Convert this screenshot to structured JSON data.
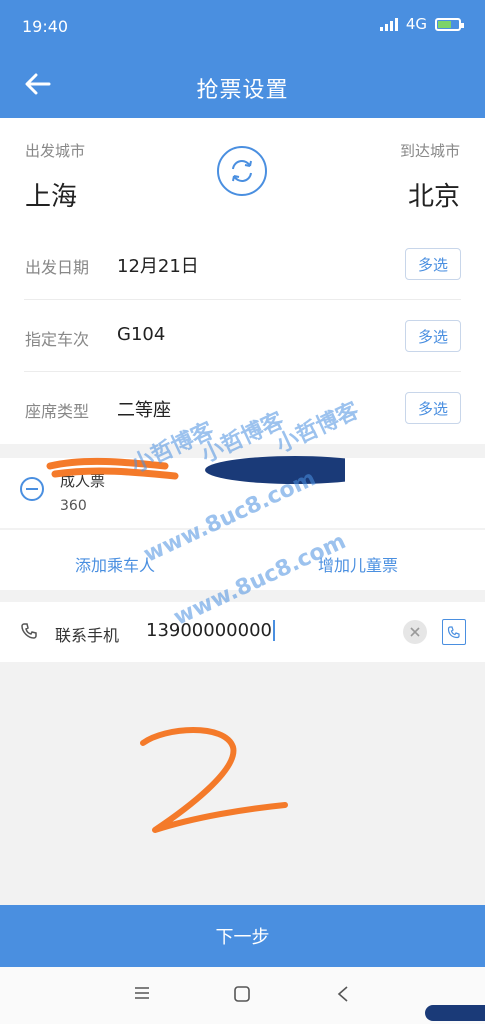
{
  "status_bar": {
    "time": "19:40",
    "network": "4G"
  },
  "header": {
    "title": "抢票设置",
    "back_icon": "back-arrow-icon"
  },
  "route": {
    "from_label": "出发城市",
    "from_city": "上海",
    "to_label": "到达城市",
    "to_city": "北京"
  },
  "settings": [
    {
      "label": "出发日期",
      "value": "12月21日",
      "button": "多选"
    },
    {
      "label": "指定车次",
      "value": "G104",
      "button": "多选"
    },
    {
      "label": "座席类型",
      "value": "二等座",
      "button": "多选"
    }
  ],
  "passenger": {
    "name_partial": "成人票",
    "id_partial": "360"
  },
  "actions": {
    "add_passenger": "添加乘车人",
    "add_child": "增加儿童票"
  },
  "contact": {
    "label": "联系手机",
    "phone": "13900000000"
  },
  "watermark": {
    "line1": "小哲博客",
    "line2": "www.8uc8.com"
  },
  "footer": {
    "next_label": "下一步"
  },
  "colors": {
    "primary": "#4a8fe0",
    "accent_mark": "#f47a2a"
  }
}
